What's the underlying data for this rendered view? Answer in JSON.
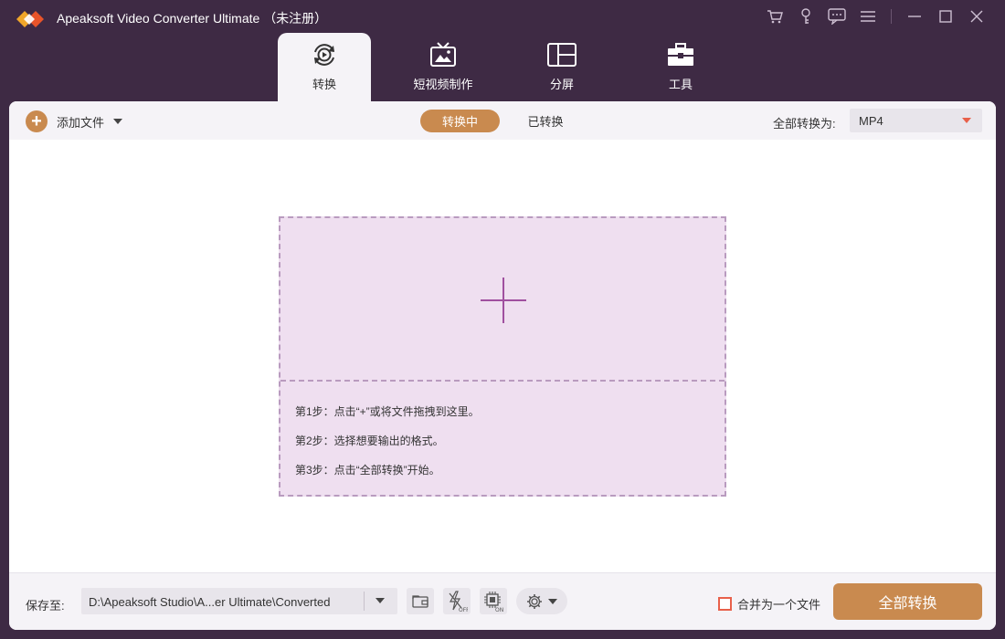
{
  "app": {
    "title": "Apeaksoft Video Converter Ultimate （未注册）"
  },
  "window_controls": [
    "cart-icon",
    "key-icon",
    "feedback-icon",
    "menu-icon",
    "minimize-icon",
    "maximize-icon",
    "close-icon"
  ],
  "tabs": [
    {
      "label": "转换",
      "icon": "convert-icon",
      "active": true
    },
    {
      "label": "短视频制作",
      "icon": "mv-icon",
      "active": false
    },
    {
      "label": "分屏",
      "icon": "collage-icon",
      "active": false
    },
    {
      "label": "工具",
      "icon": "toolbox-icon",
      "active": false
    }
  ],
  "toolbar": {
    "add_file_label": "添加文件",
    "converting_label": "转换中",
    "converted_label": "已转换",
    "convert_all_to_label": "全部转换为:",
    "format_value": "MP4"
  },
  "dropzone": {
    "steps": [
      "第1步：点击“+”或将文件拖拽到这里。",
      "第2步：选择想要输出的格式。",
      "第3步：点击“全部转换”开始。"
    ]
  },
  "bottom": {
    "save_to_label": "保存至:",
    "path_value": "D:\\Apeaksoft Studio\\A...er Ultimate\\Converted",
    "merge_label": "合并为一个文件",
    "merge_checked": false,
    "convert_all_button": "全部转换"
  },
  "colors": {
    "accent": "#c98a4f",
    "title_bar": "#3e2a44",
    "dropzone_bg": "#efdff0",
    "plus": "#a0509f",
    "highlight": "#e8604a"
  }
}
